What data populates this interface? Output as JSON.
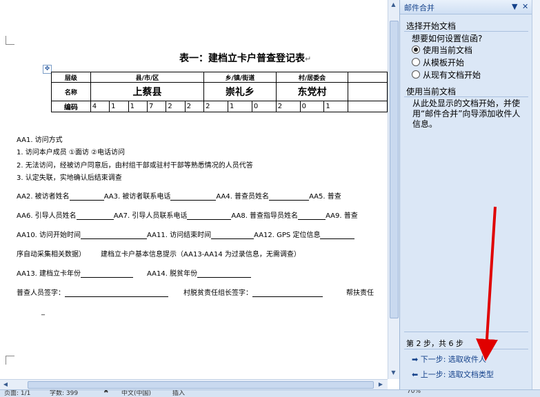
{
  "document": {
    "title": "表一：建档立卡户普查登记表",
    "table": {
      "row1": [
        "层级",
        "县/市/区",
        "乡/镇/街道",
        "村/居委会"
      ],
      "row2_label": "名称",
      "row2_values": [
        "上蔡县",
        "崇礼乡",
        "东党村"
      ],
      "row3_label": "编码",
      "codes": [
        "4",
        "1",
        "1",
        "7",
        "2",
        "2",
        "2",
        "1",
        "0",
        "2",
        "0",
        "1"
      ]
    },
    "lines": {
      "aa1": "AA1. 访问方式",
      "opt1": "1. 访问本户成员   ①面访   ②电话访问",
      "opt2": "2. 无法访问，经被访户同意后，由村组干部或驻村干部等熟悉情况的人员代答",
      "opt3": "3. 认定失联，实地确认后结束调查",
      "aa2": "AA2. 被访者姓名",
      "aa3": "AA3. 被访者联系电话",
      "aa4": "AA4. 普查员姓名",
      "aa5": "AA5. 普查",
      "aa6": "AA6. 引导人员姓名",
      "aa7": "AA7. 引导人员联系电话",
      "aa8": "AA8. 普查指导员姓名",
      "aa9": "AA9. 普查",
      "aa10": "AA10. 访问开始时间",
      "aa11": "AA11. 访问结束时间",
      "aa12": "AA12. GPS 定位信息",
      "auto": "序自动采集相关数据）",
      "hint": "建档立卡户基本信息提示（AA13-AA14 为过录信息，无需调查）",
      "aa13": "AA13. 建档立卡年份",
      "aa14": "AA14. 脱贫年份",
      "sign1": "普查人员签字：",
      "sign2": "村脱贫责任组长签字：",
      "sign3": "帮扶责任"
    }
  },
  "pane": {
    "title": "邮件合并",
    "section1": "选择开始文档",
    "question": "想要如何设置信函?",
    "options": [
      "使用当前文档",
      "从模板开始",
      "从现有文档开始"
    ],
    "selected_option": 0,
    "section2": "使用当前文档",
    "description": "从此处显示的文档开始，并使用“邮件合并”向导添加收件人信息。",
    "step": "第 2 步，共 6 步",
    "next": "下一步: 选取收件人",
    "prev": "上一步: 选取文档类型"
  },
  "status": {
    "page": "页面: 1/1",
    "words": "字数: 399",
    "lang": "中文(中国)",
    "mode": "插入",
    "zoom": "70%"
  },
  "colors": {
    "annotation_arrow": "#e00000",
    "pane_bg": "#dbe7f6",
    "link": "#15428b"
  }
}
